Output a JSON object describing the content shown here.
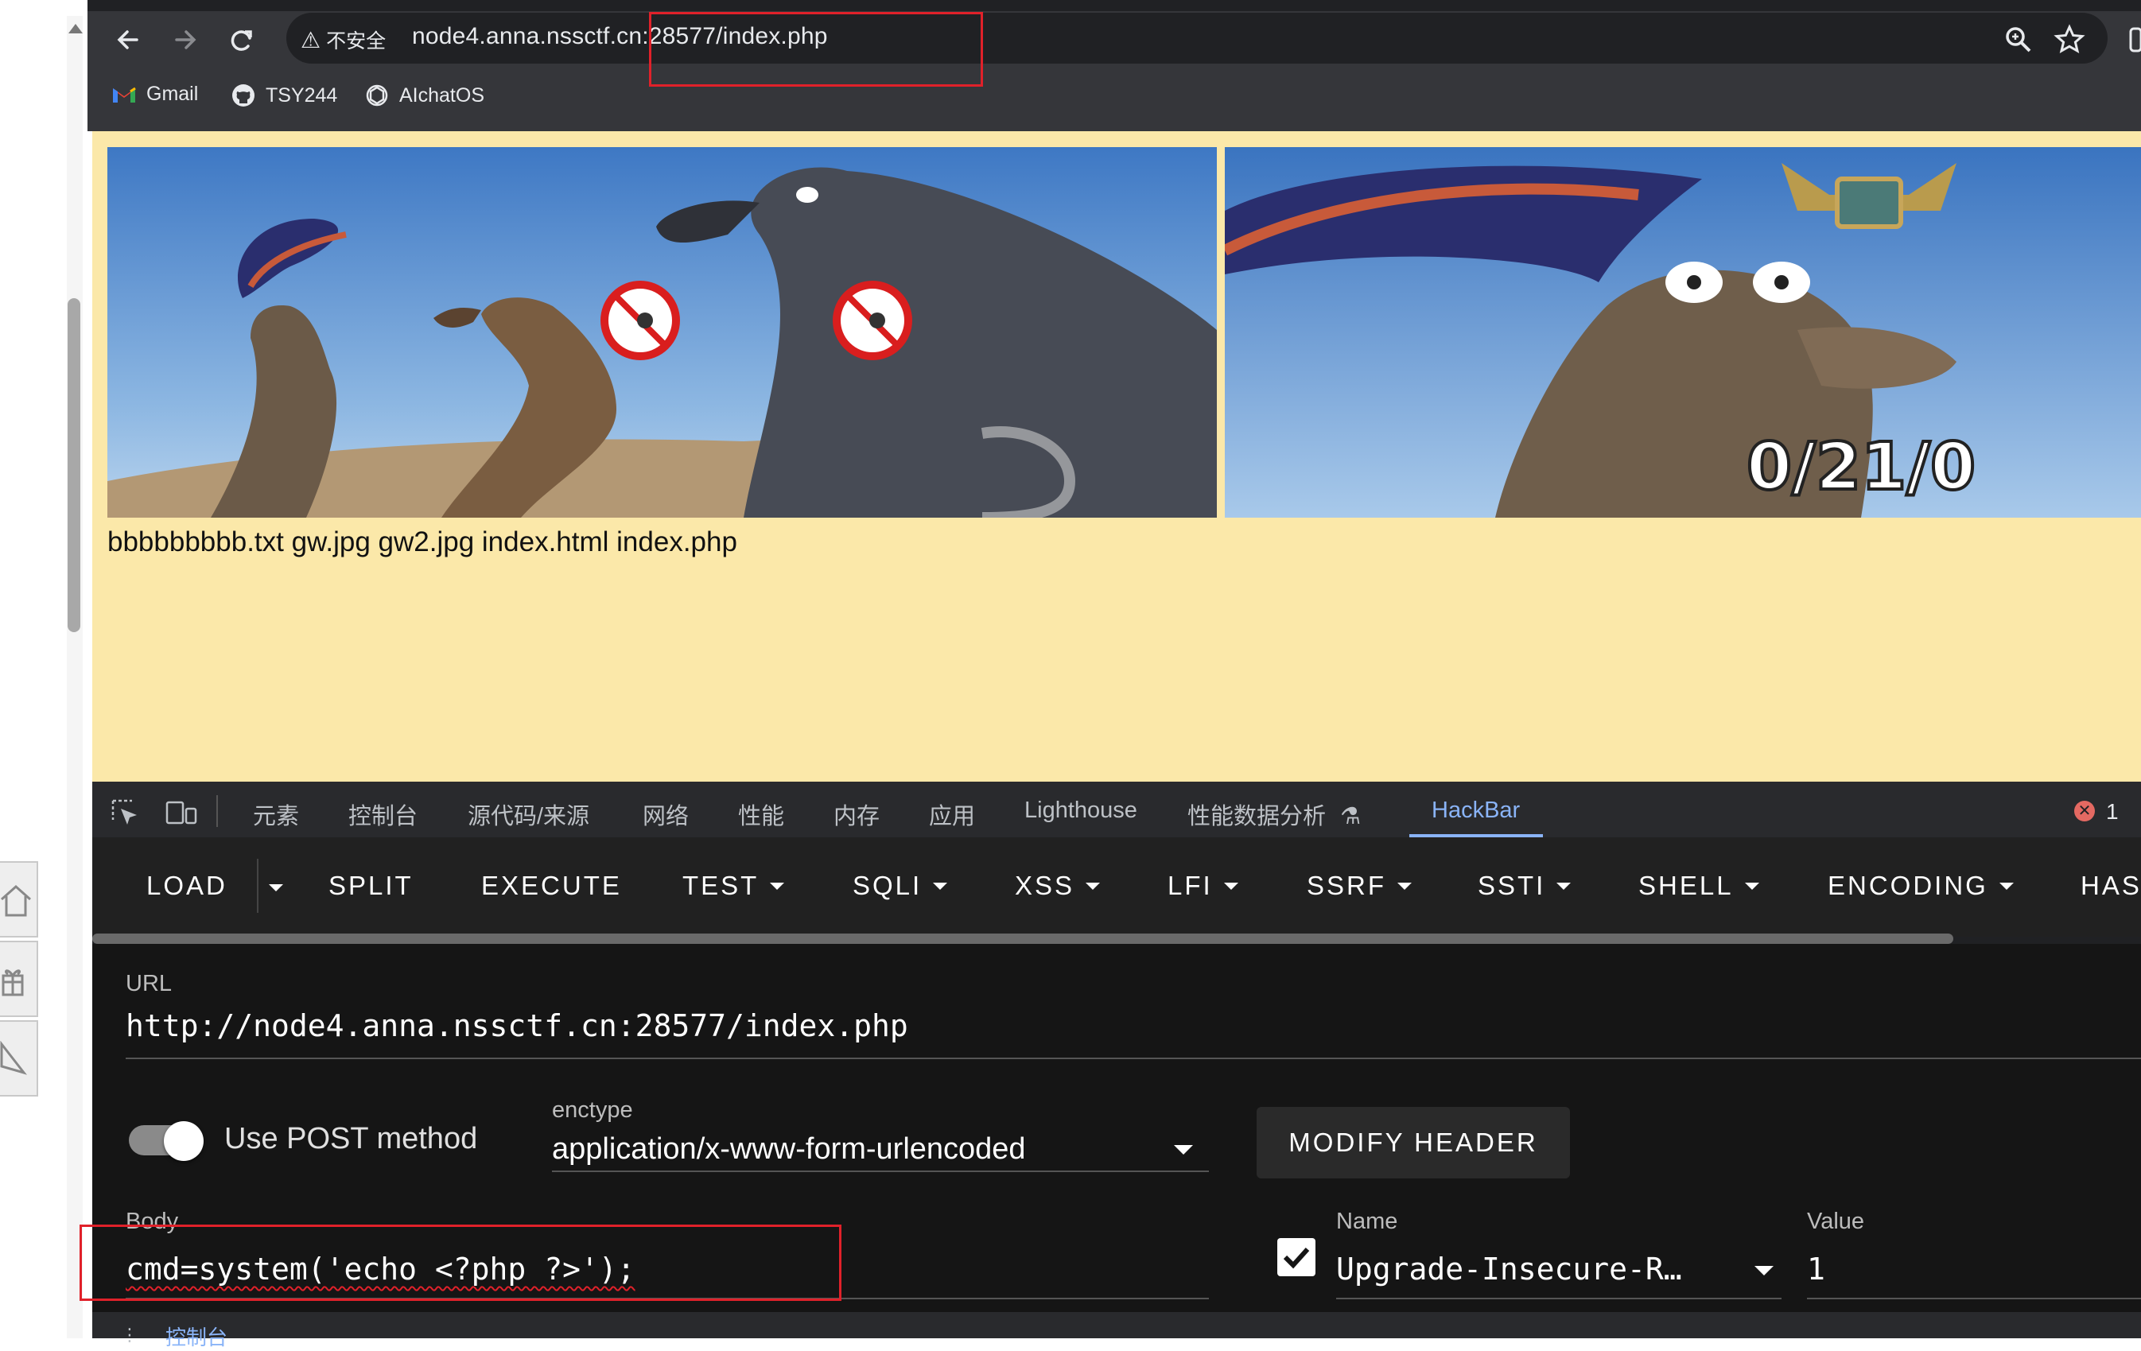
{
  "browser": {
    "insecure_label": "不安全",
    "url": "node4.anna.nssctf.cn:28577/index.php",
    "bookmarks": [
      {
        "label": "Gmail",
        "icon": "gmail-icon"
      },
      {
        "label": "TSY244",
        "icon": "github-icon"
      },
      {
        "label": "AIchatOS",
        "icon": "openai-icon"
      }
    ]
  },
  "page": {
    "images": [
      {
        "name": "gw.jpg",
        "description_icon": "sea-lion-meme-image"
      },
      {
        "name": "gw2.jpg",
        "caption": "0/21/0"
      }
    ],
    "file_list": "bbbbbbbbb.txt gw.jpg gw2.jpg index.html index.php"
  },
  "devtools": {
    "tabs": [
      "元素",
      "控制台",
      "源代码/来源",
      "网络",
      "性能",
      "内存",
      "应用",
      "Lighthouse",
      "性能数据分析",
      "HackBar"
    ],
    "active_tab": "HackBar",
    "error_count": "1",
    "console_label": "控制台"
  },
  "hackbar": {
    "toolbar": [
      "LOAD",
      "SPLIT",
      "EXECUTE",
      "TEST",
      "SQLI",
      "XSS",
      "LFI",
      "SSRF",
      "SSTI",
      "SHELL",
      "ENCODING",
      "HAS"
    ],
    "url_label": "URL",
    "url_value": "http://node4.anna.nssctf.cn:28577/index.php",
    "post_label": "Use POST method",
    "post_enabled": true,
    "enctype_label": "enctype",
    "enctype_value": "application/x-www-form-urlencoded",
    "modify_header_label": "MODIFY HEADER",
    "body_label": "Body",
    "body_value": "cmd=system('echo <?php ?>');",
    "header_name_label": "Name",
    "header_name_value": "Upgrade-Insecure-R…",
    "header_value_label": "Value",
    "header_value_value": "1",
    "header_enabled": true
  },
  "colors": {
    "page_background": "#fbe8a9",
    "highlight_box": "#e0212a",
    "devtools_active": "#8ab4f8"
  }
}
